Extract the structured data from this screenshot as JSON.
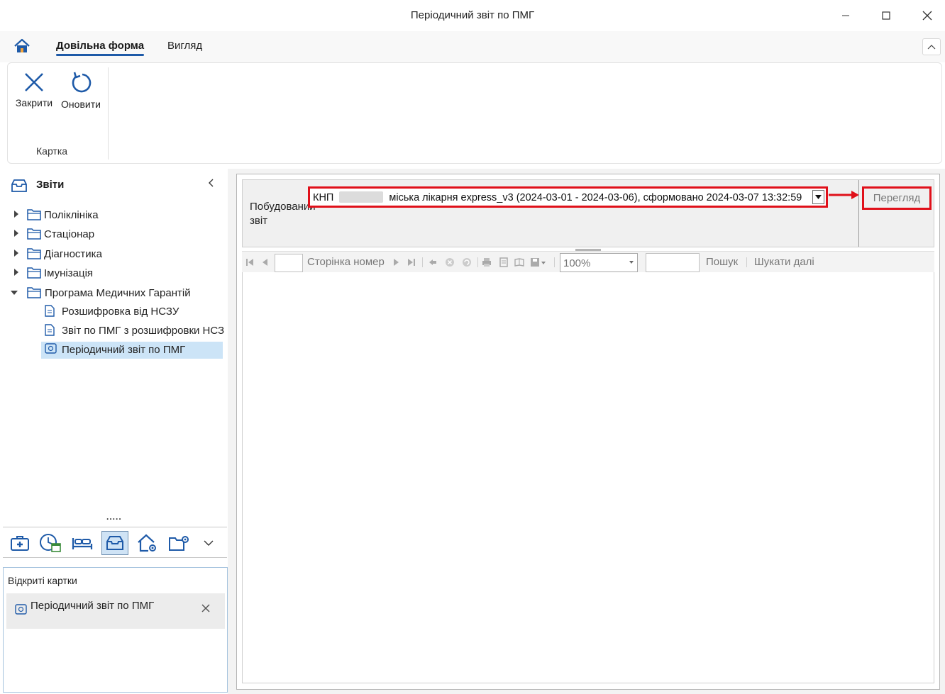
{
  "window": {
    "title": "Періодичний звіт по ПМГ"
  },
  "tabs": {
    "active": "Довільна форма",
    "view": "Вигляд"
  },
  "ribbon": {
    "close_label": "Закрити",
    "refresh_label": "Оновити",
    "group_label": "Картка"
  },
  "sidebar": {
    "title": "Звіти",
    "folders": [
      {
        "label": "Поліклініка"
      },
      {
        "label": "Стаціонар"
      },
      {
        "label": "Діагностика"
      },
      {
        "label": "Імунізація"
      },
      {
        "label": "Програма Медичних Гарантій"
      }
    ],
    "items": [
      {
        "label": "Розшифровка від НСЗУ"
      },
      {
        "label": "Звіт по ПМГ з розшифровки НСЗ"
      },
      {
        "label": "Періодичний звіт по ПМГ"
      }
    ],
    "splitter": "....."
  },
  "open_cards": {
    "header": "Відкриті картки",
    "items": [
      {
        "label": "Періодичний звіт по ПМГ"
      }
    ]
  },
  "report": {
    "param_label": "Побудований звіт",
    "selected_report_prefix": "КНП",
    "selected_report_suffix": "міська лікарня   express_v3 (2024-03-01 - 2024-03-06), сформовано 2024-03-07 13:32:59",
    "preview_button": "Перегляд",
    "page_label": "Сторінка номер",
    "zoom_value": "100%",
    "search_label": "Пошук",
    "find_next_label": "Шукати далі"
  },
  "colors": {
    "accent": "#1e5aa8",
    "highlight": "#e0101a",
    "selected_bg": "#cce4f7"
  }
}
